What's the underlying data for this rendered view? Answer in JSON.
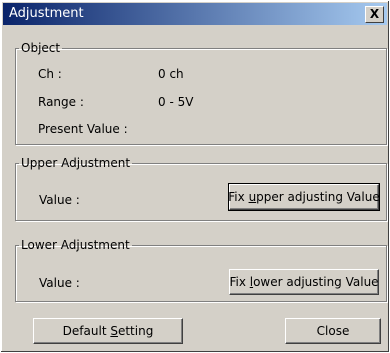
{
  "window": {
    "title": "Adjustment",
    "close_glyph": "X"
  },
  "object_group": {
    "legend": "Object",
    "ch_label": "Ch :",
    "ch_value": "0 ch",
    "range_label": "Range :",
    "range_value": "0 - 5V",
    "present_label": "Present Value :",
    "present_value": ""
  },
  "upper_group": {
    "legend": "Upper Adjustment",
    "value_label": "Value :",
    "button_pre": "Fix ",
    "button_accel": "u",
    "button_post": "pper adjusting Value"
  },
  "lower_group": {
    "legend": "Lower Adjustment",
    "value_label": "Value :",
    "button_pre": "Fix ",
    "button_accel": "l",
    "button_post": "ower adjusting Value"
  },
  "footer": {
    "default_pre": "Default ",
    "default_accel": "S",
    "default_post": "etting",
    "close_label": "Close"
  }
}
